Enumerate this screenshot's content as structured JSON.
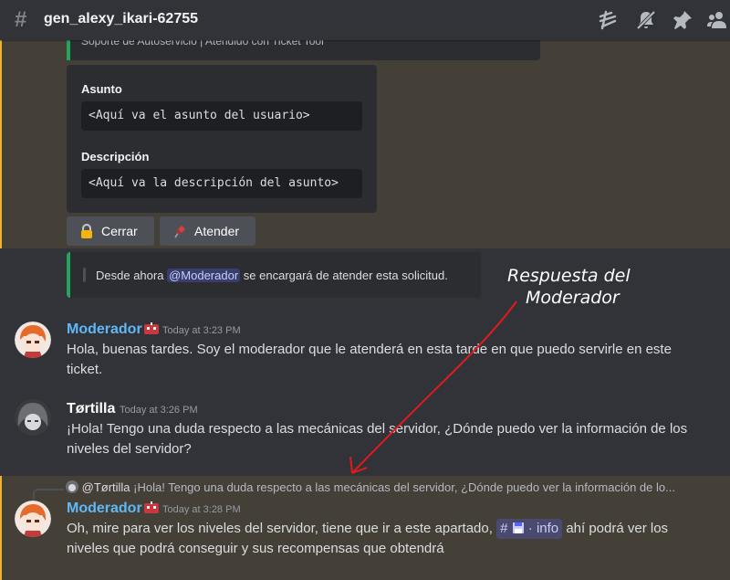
{
  "header": {
    "channel_name": "gen_alexy_ikari-62755"
  },
  "first_message": {
    "embed_top_text": "Soporte de Autoservicio | Atendido con Ticket Tool",
    "form": {
      "field1_label": "Asunto",
      "field1_value": "<Aquí va el asunto del usuario>",
      "field2_label": "Descripción",
      "field2_value": "<Aquí va la descripción del asunto>"
    },
    "buttons": {
      "close_label": "Cerrar",
      "attend_label": "Atender"
    }
  },
  "notice": {
    "text_before": "Desde ahora",
    "mention": "@Moderador",
    "text_after": "se encargará de atender esta solicitud."
  },
  "messages": [
    {
      "username": "Moderador",
      "username_color": "#5fb8f7",
      "timestamp": "Today at 3:23 PM",
      "text": "Hola, buenas tardes. Soy el moderador que le atenderá en esta tarde en que puedo servirle en este ticket."
    },
    {
      "username": "Tørtilla",
      "username_color": "#ffffff",
      "timestamp": "Today at 3:26 PM",
      "text": "¡Hola! Tengo una duda respecto a las mecánicas del servidor, ¿Dónde puedo ver la información de los niveles del servidor?"
    }
  ],
  "reply": {
    "replied_user": "@Tørtilla",
    "replied_text": "¡Hola! Tengo una duda respecto a las mecánicas del servidor, ¿Dónde puedo ver la información de lo...",
    "username": "Moderador",
    "timestamp": "Today at 3:28 PM",
    "text_before": "Oh, mire para ver los niveles del servidor, tiene que ir a este apartado,",
    "channel_label": "info",
    "text_after": "ahí podrá ver los niveles que podrá conseguir y sus recompensas que obtendrá"
  },
  "annotation": {
    "line1": "Respuesta del",
    "line2": "Moderador"
  },
  "colors": {
    "accent_green": "#23a55a",
    "mention_highlight": "#f0b132",
    "annotation_arrow": "#e01b1b"
  },
  "icons": [
    "hash-icon",
    "threads-icon",
    "mute-bell-icon",
    "pin-icon",
    "members-icon",
    "lock-emoji-icon",
    "pushpin-emoji-icon",
    "floppy-disk-icon",
    "bot-badge-icon"
  ]
}
